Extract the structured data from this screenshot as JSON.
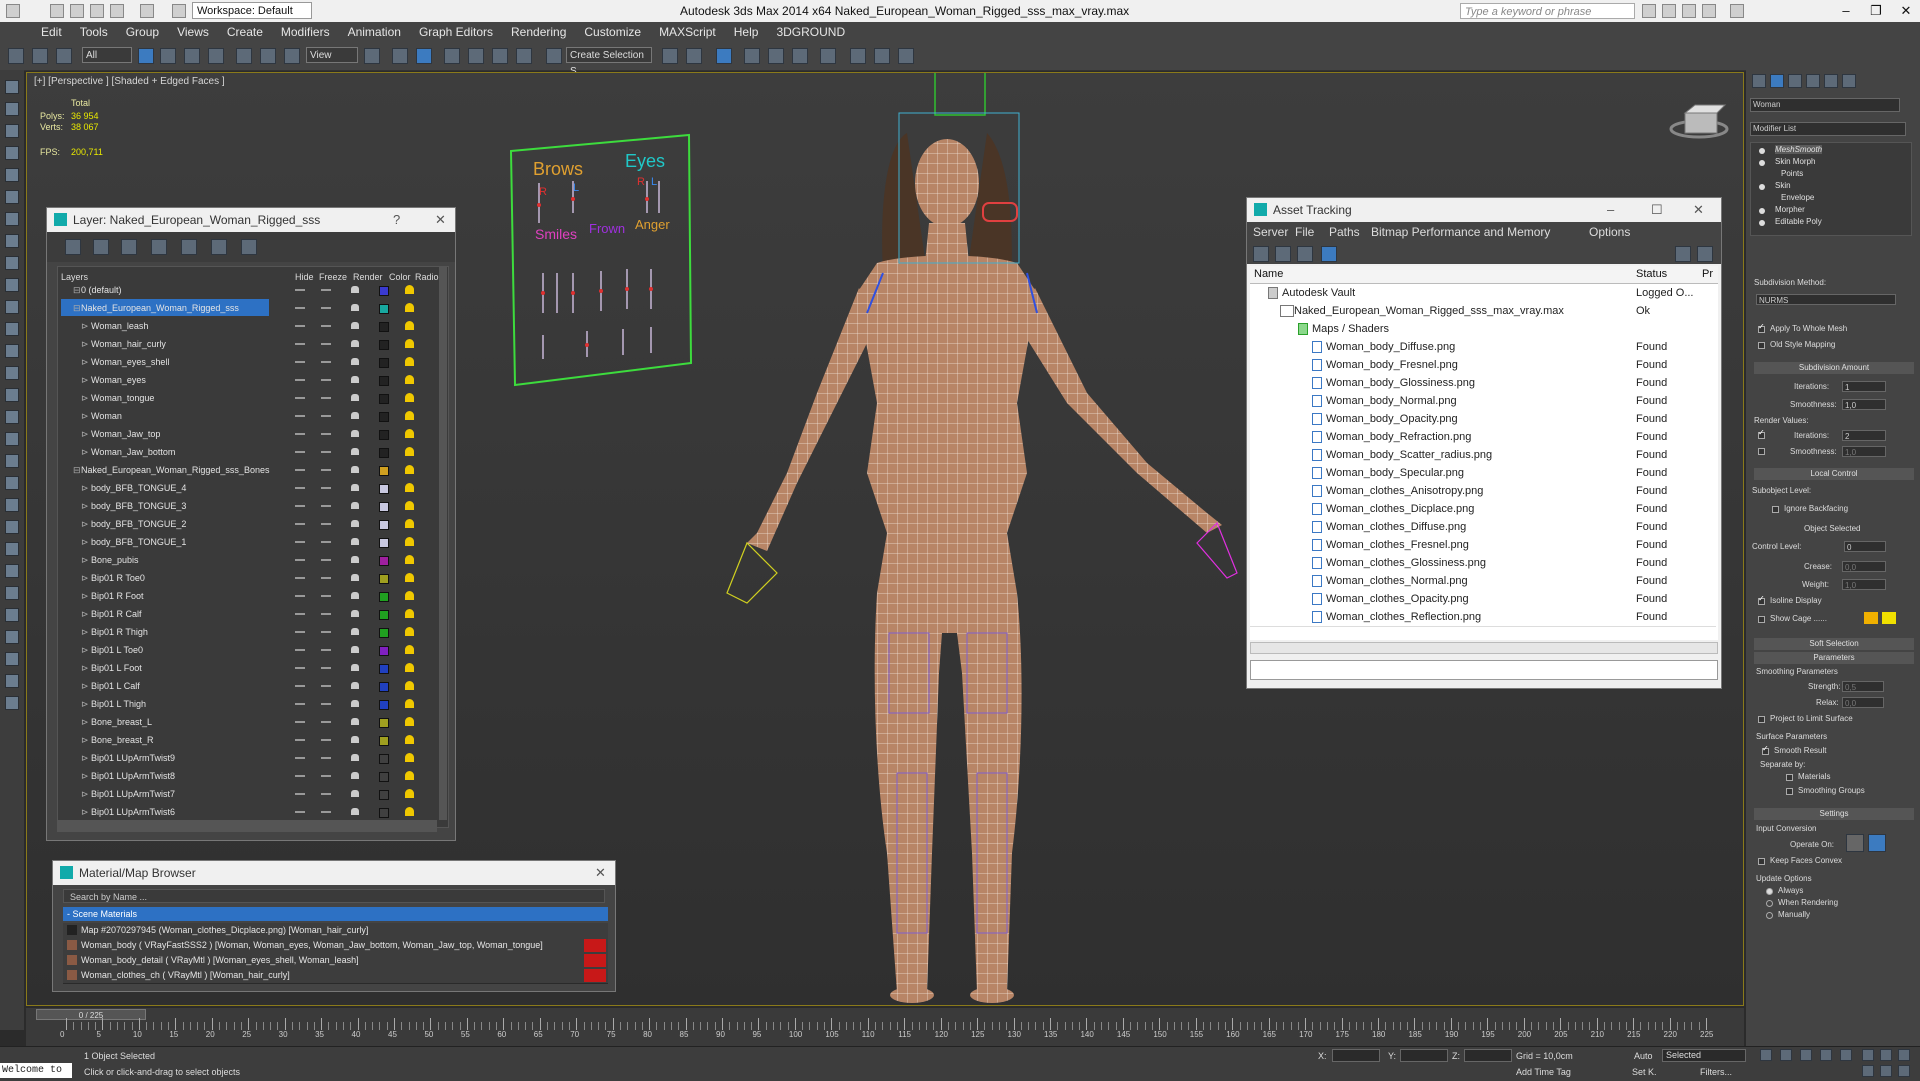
{
  "titlebar": {
    "app_title": "Autodesk 3ds Max  2014 x64     Naked_European_Woman_Rigged_sss_max_vray.max",
    "workspace": "Workspace: Default",
    "search_placeholder": "Type a keyword or phrase"
  },
  "menu": [
    "Edit",
    "Tools",
    "Group",
    "Views",
    "Create",
    "Modifiers",
    "Animation",
    "Graph Editors",
    "Rendering",
    "Customize",
    "MAXScript",
    "Help",
    "3DGROUND"
  ],
  "toolbar": {
    "selection_filter": "All",
    "ref_coord": "View",
    "named_selection": "Create Selection S"
  },
  "viewport": {
    "label": "[+] [Perspective ] [Shaded + Edged Faces ]",
    "stats_total": "Total",
    "polys_label": "Polys:",
    "polys_value": "36 954",
    "verts_label": "Verts:",
    "verts_value": "38 067",
    "fps_label": "FPS:",
    "fps_value": "200,711",
    "facial_rig": {
      "brows": "Brows",
      "eyes": "Eyes",
      "r": "R",
      "l": "L",
      "smiles": "Smiles",
      "frown": "Frown",
      "anger": "Anger"
    }
  },
  "layer_window": {
    "title": "Layer: Naked_European_Woman_Rigged_sss",
    "help": "?",
    "columns": [
      "Layers",
      "Hide",
      "Freeze",
      "Render",
      "Color",
      "Radio"
    ],
    "rows": [
      {
        "name": "0 (default)",
        "indent": 0,
        "color": "#3a3ad0"
      },
      {
        "name": "Naked_European_Woman_Rigged_sss",
        "indent": 0,
        "color": "#18a8a0",
        "selected": true
      },
      {
        "name": "Woman_leash",
        "indent": 1,
        "color": "#222222"
      },
      {
        "name": "Woman_hair_curly",
        "indent": 1,
        "color": "#222222"
      },
      {
        "name": "Woman_eyes_shell",
        "indent": 1,
        "color": "#222222"
      },
      {
        "name": "Woman_eyes",
        "indent": 1,
        "color": "#222222"
      },
      {
        "name": "Woman_tongue",
        "indent": 1,
        "color": "#222222"
      },
      {
        "name": "Woman",
        "indent": 1,
        "color": "#222222"
      },
      {
        "name": "Woman_Jaw_top",
        "indent": 1,
        "color": "#222222"
      },
      {
        "name": "Woman_Jaw_bottom",
        "indent": 1,
        "color": "#222222"
      },
      {
        "name": "Naked_European_Woman_Rigged_sss_Bones",
        "indent": 0,
        "color": "#d0a020"
      },
      {
        "name": "body_BFB_TONGUE_4",
        "indent": 1,
        "color": "#c8c8e0"
      },
      {
        "name": "body_BFB_TONGUE_3",
        "indent": 1,
        "color": "#c8c8e0"
      },
      {
        "name": "body_BFB_TONGUE_2",
        "indent": 1,
        "color": "#c8c8e0"
      },
      {
        "name": "body_BFB_TONGUE_1",
        "indent": 1,
        "color": "#c8c8e0"
      },
      {
        "name": "Bone_pubis",
        "indent": 1,
        "color": "#a020a0"
      },
      {
        "name": "Bip01 R Toe0",
        "indent": 1,
        "color": "#a0a020"
      },
      {
        "name": "Bip01 R Foot",
        "indent": 1,
        "color": "#20a020"
      },
      {
        "name": "Bip01 R Calf",
        "indent": 1,
        "color": "#20a020"
      },
      {
        "name": "Bip01 R Thigh",
        "indent": 1,
        "color": "#20a020"
      },
      {
        "name": "Bip01 L Toe0",
        "indent": 1,
        "color": "#8020c0"
      },
      {
        "name": "Bip01 L Foot",
        "indent": 1,
        "color": "#2040c0"
      },
      {
        "name": "Bip01 L Calf",
        "indent": 1,
        "color": "#2040c0"
      },
      {
        "name": "Bip01 L Thigh",
        "indent": 1,
        "color": "#2040c0"
      },
      {
        "name": "Bone_breast_L",
        "indent": 1,
        "color": "#a0a020"
      },
      {
        "name": "Bone_breast_R",
        "indent": 1,
        "color": "#a0a020"
      },
      {
        "name": "Bip01 LUpArmTwist9",
        "indent": 1,
        "color": "#404040"
      },
      {
        "name": "Bip01 LUpArmTwist8",
        "indent": 1,
        "color": "#404040"
      },
      {
        "name": "Bip01 LUpArmTwist7",
        "indent": 1,
        "color": "#404040"
      },
      {
        "name": "Bip01 LUpArmTwist6",
        "indent": 1,
        "color": "#404040"
      }
    ]
  },
  "asset_window": {
    "title": "Asset Tracking",
    "menu": [
      "Server",
      "File",
      "Paths",
      "Bitmap Performance and Memory",
      "Options"
    ],
    "columns": [
      "Name",
      "Status",
      "Pr"
    ],
    "rows": [
      {
        "name": "Autodesk Vault",
        "status": "Logged O...",
        "indent": 0,
        "kind": "vault"
      },
      {
        "name": "Naked_European_Woman_Rigged_sss_max_vray.max",
        "status": "Ok",
        "indent": 1,
        "kind": "scene"
      },
      {
        "name": "Maps / Shaders",
        "status": "",
        "indent": 2,
        "kind": "folder"
      },
      {
        "name": "Woman_body_Diffuse.png",
        "status": "Found",
        "indent": 3,
        "kind": "file"
      },
      {
        "name": "Woman_body_Fresnel.png",
        "status": "Found",
        "indent": 3,
        "kind": "file"
      },
      {
        "name": "Woman_body_Glossiness.png",
        "status": "Found",
        "indent": 3,
        "kind": "file"
      },
      {
        "name": "Woman_body_Normal.png",
        "status": "Found",
        "indent": 3,
        "kind": "file"
      },
      {
        "name": "Woman_body_Opacity.png",
        "status": "Found",
        "indent": 3,
        "kind": "file"
      },
      {
        "name": "Woman_body_Refraction.png",
        "status": "Found",
        "indent": 3,
        "kind": "file"
      },
      {
        "name": "Woman_body_Scatter_radius.png",
        "status": "Found",
        "indent": 3,
        "kind": "file"
      },
      {
        "name": "Woman_body_Specular.png",
        "status": "Found",
        "indent": 3,
        "kind": "file"
      },
      {
        "name": "Woman_clothes_Anisotropy.png",
        "status": "Found",
        "indent": 3,
        "kind": "file"
      },
      {
        "name": "Woman_clothes_Dicplace.png",
        "status": "Found",
        "indent": 3,
        "kind": "file"
      },
      {
        "name": "Woman_clothes_Diffuse.png",
        "status": "Found",
        "indent": 3,
        "kind": "file"
      },
      {
        "name": "Woman_clothes_Fresnel.png",
        "status": "Found",
        "indent": 3,
        "kind": "file"
      },
      {
        "name": "Woman_clothes_Glossiness.png",
        "status": "Found",
        "indent": 3,
        "kind": "file"
      },
      {
        "name": "Woman_clothes_Normal.png",
        "status": "Found",
        "indent": 3,
        "kind": "file"
      },
      {
        "name": "Woman_clothes_Opacity.png",
        "status": "Found",
        "indent": 3,
        "kind": "file"
      },
      {
        "name": "Woman_clothes_Reflection.png",
        "status": "Found",
        "indent": 3,
        "kind": "file"
      }
    ]
  },
  "material_window": {
    "title": "Material/Map Browser",
    "search_placeholder": "Search by Name ...",
    "group": "- Scene Materials",
    "items": [
      "Map #2070297945 (Woman_clothes_Dicplace.png) [Woman_hair_curly]",
      "Woman_body  ( VRayFastSSS2 ) [Woman, Woman_eyes, Woman_Jaw_bottom, Woman_Jaw_top, Woman_tongue]",
      "Woman_body_detail  ( VRayMtl ) [Woman_eyes_shell, Woman_leash]",
      "Woman_clothes_ch  ( VRayMtl ) [Woman_hair_curly]"
    ]
  },
  "command_panel": {
    "object_name": "Woman",
    "modifier_list": "Modifier List",
    "stack": [
      {
        "name": "MeshSmooth",
        "level": 0
      },
      {
        "name": "Skin Morph",
        "level": 0
      },
      {
        "name": "Points",
        "level": 1
      },
      {
        "name": "Skin",
        "level": 0
      },
      {
        "name": "Envelope",
        "level": 1
      },
      {
        "name": "Morpher",
        "level": 0
      },
      {
        "name": "Editable Poly",
        "level": 0
      }
    ],
    "subdivision_method_label": "Subdivision Method:",
    "subdivision_method": "NURMS",
    "apply_whole_mesh": "Apply To Whole Mesh",
    "old_style_mapping": "Old Style Mapping",
    "subdivision_amount": "Subdivision Amount",
    "iterations_label": "Iterations:",
    "iterations_value": "1",
    "smoothness_label": "Smoothness:",
    "smoothness_value": "1,0",
    "render_values": "Render Values:",
    "render_iterations_value": "2",
    "render_smoothness_value": "1,0",
    "local_control": "Local Control",
    "subobject_level": "Subobject Level:",
    "ignore_backfacing": "Ignore Backfacing",
    "object_selected": "Object Selected",
    "control_level": "Control Level:",
    "control_level_value": "0",
    "crease_label": "Crease:",
    "crease_value": "0,0",
    "weight_label": "Weight:",
    "weight_value": "1,0",
    "isoline_display": "Isoline Display",
    "show_cage": "Show Cage ......",
    "soft_selection": "Soft Selection",
    "parameters": "Parameters",
    "smoothing_parameters": "Smoothing Parameters",
    "strength_label": "Strength:",
    "strength_value": "0,5",
    "relax_label": "Relax:",
    "relax_value": "0,0",
    "project_limit": "Project to Limit Surface",
    "surface_parameters": "Surface Parameters",
    "smooth_result": "Smooth Result",
    "separate_by": "Separate by:",
    "materials": "Materials",
    "smoothing_groups": "Smoothing Groups",
    "settings": "Settings",
    "input_conversion": "Input Conversion",
    "operate_on": "Operate On:",
    "keep_faces_convex": "Keep Faces Convex",
    "update_options": "Update Options",
    "always": "Always",
    "when_rendering": "When Rendering",
    "manually": "Manually"
  },
  "timeline": {
    "frame": "0 / 225",
    "ticks": [
      0,
      5,
      10,
      15,
      20,
      25,
      30,
      35,
      40,
      45,
      50,
      55,
      60,
      65,
      70,
      75,
      80,
      85,
      90,
      95,
      100,
      105,
      110,
      115,
      120,
      125,
      130,
      135,
      140,
      145,
      150,
      155,
      160,
      165,
      170,
      175,
      180,
      185,
      190,
      195,
      200,
      205,
      210,
      215,
      220,
      225
    ]
  },
  "statusbar": {
    "maxscript": "Welcome to",
    "selected": "1 Object Selected",
    "prompt": "Click or click-and-drag to select objects",
    "x_label": "X:",
    "y_label": "Y:",
    "z_label": "Z:",
    "grid": "Grid = 10,0cm",
    "add_time_tag": "Add Time Tag",
    "auto": "Auto",
    "set_k": "Set K.",
    "key_mode": "Selected",
    "filters": "Filters..."
  }
}
